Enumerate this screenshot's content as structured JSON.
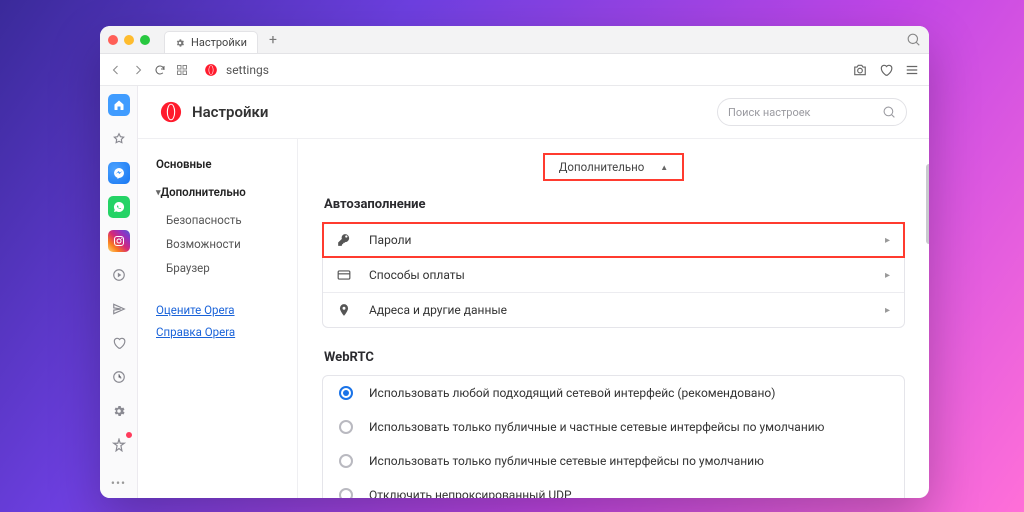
{
  "tab": {
    "label": "Настройки"
  },
  "address": {
    "text": "settings"
  },
  "page": {
    "title": "Настройки"
  },
  "search_settings": {
    "placeholder": "Поиск настроек"
  },
  "nav": {
    "basic": "Основные",
    "advanced": "Дополнительно",
    "items": {
      "security": "Безопасность",
      "features": "Возможности",
      "browser": "Браузер"
    },
    "links": {
      "rate": "Оцените Opera",
      "help": "Справка Opera"
    }
  },
  "advanced_pill": "Дополнительно",
  "autofill": {
    "title": "Автозаполнение",
    "passwords": "Пароли",
    "payment": "Способы оплаты",
    "addresses": "Адреса и другие данные"
  },
  "webrtc": {
    "title": "WebRTC",
    "opt1": "Использовать любой подходящий сетевой интерфейс (рекомендовано)",
    "opt2": "Использовать только публичные и частные сетевые интерфейсы по умолчанию",
    "opt3": "Использовать только публичные сетевые интерфейсы по умолчанию",
    "opt4": "Отключить непроксированный UDP"
  }
}
